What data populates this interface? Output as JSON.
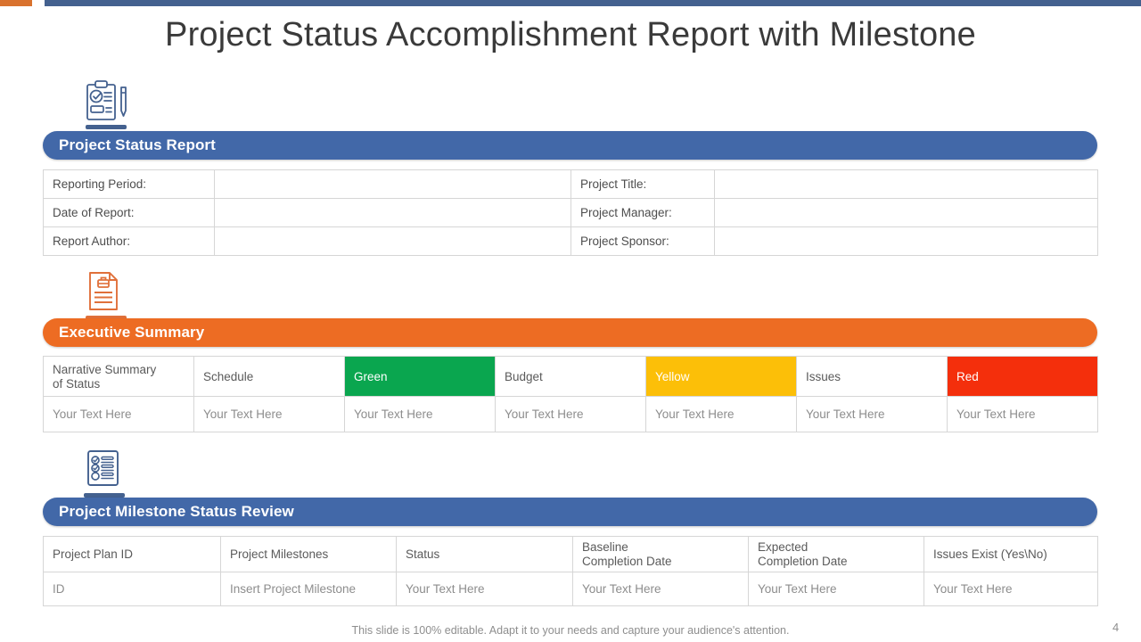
{
  "decor": {
    "top_bar_orange_color": "#d9722e",
    "top_bar_blue_color": "#44618f"
  },
  "title": "Project Status Accomplishment Report with Milestone",
  "sections": [
    {
      "icon": "clipboard-checklist-pen-icon",
      "heading": "Project Status Report",
      "heading_color": "#4268a8"
    },
    {
      "icon": "document-report-icon",
      "heading": "Executive Summary",
      "heading_color": "#ed6c23"
    },
    {
      "icon": "checklist-review-icon",
      "heading": "Project Milestone Status Review",
      "heading_color": "#4268a8"
    }
  ],
  "status_report_table": {
    "rows": [
      {
        "label_left": "Reporting Period:",
        "value_left": "",
        "label_right": "Project Title:",
        "value_right": ""
      },
      {
        "label_left": "Date of Report:",
        "value_left": "",
        "label_right": "Project Manager:",
        "value_right": ""
      },
      {
        "label_left": "Report Author:",
        "value_left": "",
        "label_right": "Project Sponsor:",
        "value_right": ""
      }
    ]
  },
  "executive_summary_table": {
    "header": [
      {
        "label": "Narrative  Summary",
        "label2": "of Status",
        "swatch": ""
      },
      {
        "label": "Schedule",
        "label2": "",
        "swatch": ""
      },
      {
        "label": "Green",
        "label2": "",
        "swatch": "#0aa64f"
      },
      {
        "label": "Budget",
        "label2": "",
        "swatch": ""
      },
      {
        "label": "Yellow",
        "label2": "",
        "swatch": "#fcbf08"
      },
      {
        "label": "Issues",
        "label2": "",
        "swatch": ""
      },
      {
        "label": "Red",
        "label2": "",
        "swatch": "#f42f0c"
      }
    ],
    "row": [
      "Your Text Here",
      "Your Text Here",
      "Your Text Here",
      "Your Text Here",
      "Your Text Here",
      "Your Text Here",
      "Your Text Here"
    ]
  },
  "milestone_table": {
    "header": [
      {
        "label": "Project Plan ID",
        "label2": ""
      },
      {
        "label": "Project Milestones",
        "label2": ""
      },
      {
        "label": "Status",
        "label2": ""
      },
      {
        "label": "Baseline",
        "label2": "Completion Date"
      },
      {
        "label": "Expected",
        "label2": "Completion Date"
      },
      {
        "label": "Issues Exist (Yes\\No)",
        "label2": ""
      }
    ],
    "row": [
      "ID",
      "Insert Project Milestone",
      "Your Text Here",
      "Your Text Here",
      "Your Text Here",
      "Your Text Here"
    ]
  },
  "footer": {
    "note": "This slide is 100% editable. Adapt it to your needs and capture your audience's attention.",
    "page_number": "4"
  }
}
